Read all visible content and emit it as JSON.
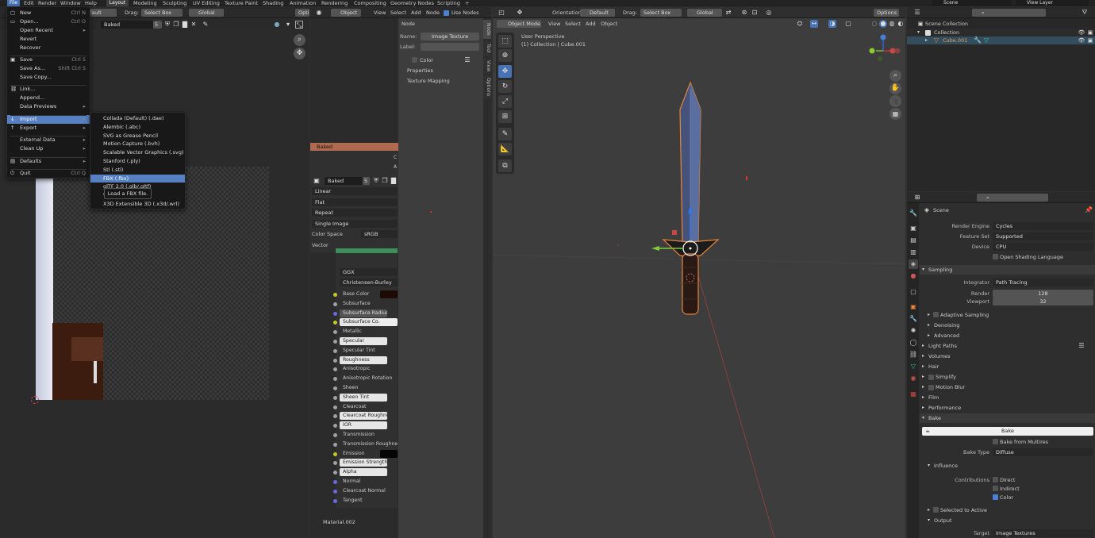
{
  "topbar": {
    "menus": [
      "File",
      "Edit",
      "Render",
      "Window",
      "Help"
    ],
    "workspaces": [
      "Layout",
      "Modeling",
      "Sculpting",
      "UV Editing",
      "Texture Paint",
      "Shading",
      "Animation",
      "Rendering",
      "Compositing",
      "Geometry Nodes",
      "Scripting",
      "+"
    ],
    "scene": "Scene",
    "view_layer": "View Layer"
  },
  "image_editor": {
    "mode": "efault",
    "drag_label": "Drag:",
    "drag_value": "Select Box",
    "orientation": "Global",
    "options": "Optio",
    "image_name": "Baked",
    "users": "5"
  },
  "file_menu": {
    "items": [
      {
        "label": "New",
        "shortcut": "Ctrl N"
      },
      {
        "label": "Open...",
        "shortcut": "Ctrl O"
      },
      {
        "label": "Open Recent",
        "shortcut": "Shift Ctrl O"
      },
      {
        "label": "Revert",
        "shortcut": ""
      },
      {
        "label": "Recover",
        "shortcut": ""
      },
      {
        "label": "Save",
        "shortcut": "Ctrl S"
      },
      {
        "label": "Save As...",
        "shortcut": "Shift Ctrl S"
      },
      {
        "label": "Save Copy...",
        "shortcut": ""
      },
      {
        "label": "Link...",
        "shortcut": ""
      },
      {
        "label": "Append...",
        "shortcut": ""
      },
      {
        "label": "Data Previews",
        "shortcut": ""
      },
      {
        "label": "Import",
        "shortcut": ""
      },
      {
        "label": "Export",
        "shortcut": ""
      },
      {
        "label": "External Data",
        "shortcut": ""
      },
      {
        "label": "Clean Up",
        "shortcut": ""
      },
      {
        "label": "Defaults",
        "shortcut": ""
      },
      {
        "label": "Quit",
        "shortcut": "Ctrl Q"
      }
    ]
  },
  "import_menu": {
    "items": [
      "Collada (Default) (.dae)",
      "Alembic (.abc)",
      "SVG as Grease Pencil",
      "Motion Capture (.bvh)",
      "Scalable Vector Graphics (.svg)",
      "Stanford (.ply)",
      "Stl (.stl)",
      "FBX (.fbx)",
      "glTF 2.0 (.glb/.gltf)",
      "Wavefront (.obj)",
      "X3D Extensible 3D (.x3d/.wrl)"
    ],
    "selected": "FBX (.fbx)",
    "tooltip": "Load a FBX file."
  },
  "node_editor": {
    "object": "Object",
    "menus": [
      "View",
      "Select",
      "Add",
      "Node"
    ],
    "use_nodes": "Use Nodes",
    "sidebar_tabs": [
      "Node",
      "Tool",
      "View",
      "Options"
    ],
    "panel_title": "Node",
    "name_label": "Name:",
    "name_value": "Image Texture",
    "label_label": "Label:",
    "color_label": "Color",
    "properties_label": "Properties",
    "texture_mapping_label": "Texture Mapping",
    "image_node": {
      "title": "Baked",
      "image": "Baked",
      "users": "5",
      "interpolation": "Linear",
      "projection": "Flat",
      "extension": "Repeat",
      "source": "Single Image",
      "color_space_label": "Color Space",
      "color_space": "sRGB",
      "vector": "Vector",
      "c": "C",
      "a": "A"
    },
    "bsdf": {
      "distribution": "GGX",
      "subsurface_method": "Christensen-Burley",
      "inputs": [
        "Base Color",
        "Subsurface",
        "Subsurface Radius",
        "Subsurface Co...",
        "Metallic",
        "Specular",
        "Specular Tint",
        "Roughness",
        "Anisotropic",
        "Anisotropic Rotation",
        "Sheen",
        "Sheen Tint",
        "Clearcoat",
        "Clearcoat Roughness",
        "IOR",
        "Transmission",
        "Transmission Roughness",
        "Emission",
        "Emission Strength",
        "Alpha",
        "Normal",
        "Clearcoat Normal",
        "Tangent"
      ]
    },
    "material": "Material.002"
  },
  "viewport": {
    "mode": "Object Mode",
    "menus": [
      "View",
      "Select",
      "Add",
      "Object"
    ],
    "orientation_label": "Orientation:",
    "orientation_value": "Default",
    "drag_label": "Drag:",
    "drag_value": "Select Box",
    "transform": "Global",
    "options": "Options",
    "perspective": "User Perspective",
    "collection_info": "(1) Collection | Cube.001"
  },
  "outliner": {
    "items": [
      {
        "label": "Scene Collection",
        "level": 0
      },
      {
        "label": "Collection",
        "level": 1
      },
      {
        "label": "Cube.001",
        "level": 2
      }
    ]
  },
  "properties": {
    "context": "Scene",
    "render_engine_label": "Render Engine",
    "render_engine": "Cycles",
    "feature_set_label": "Feature Set",
    "feature_set": "Supported",
    "device_label": "Device",
    "device": "CPU",
    "open_shading": "Open Shading Language",
    "sampling": "Sampling",
    "integrator_label": "Integrator",
    "integrator": "Path Tracing",
    "render_label": "Render",
    "render_samples": "128",
    "viewport_label": "Viewport",
    "viewport_samples": "32",
    "adaptive_sampling": "Adaptive Sampling",
    "denoising": "Denoising",
    "advanced": "Advanced",
    "panels": [
      "Light Paths",
      "Volumes",
      "Hair",
      "Simplify",
      "Motion Blur",
      "Film",
      "Performance"
    ],
    "bake_panel": "Bake",
    "bake_button": "Bake",
    "bake_from_multires": "Bake from Multires",
    "bake_type_label": "Bake Type",
    "bake_type": "Diffuse",
    "influence": "Influence",
    "contributions_label": "Contributions",
    "direct": "Direct",
    "indirect": "Indirect",
    "color": "Color",
    "selected_to_active": "Selected to Active",
    "output": "Output",
    "target_label": "Target",
    "target": "Image Textures"
  },
  "colors": {
    "accent": "#4772b3",
    "selected_item": "#5680c2",
    "object_orange": "#e8853a",
    "bake_node_header": "#b06a50"
  }
}
